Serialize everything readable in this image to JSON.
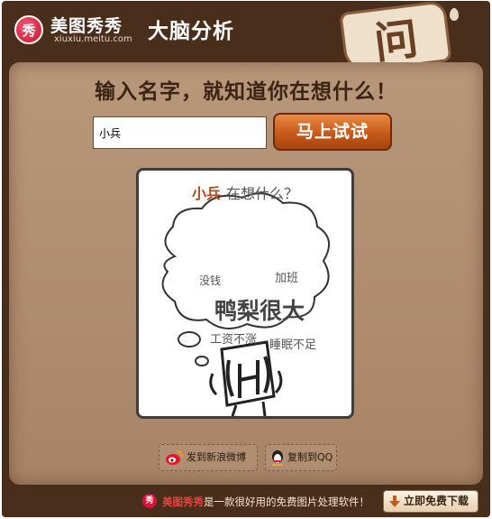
{
  "header": {
    "logo_glyph": "秀",
    "brand_name": "美图秀秀",
    "brand_url": "xiuxiu.meitu.com",
    "title": "大脑分析",
    "banner_glyph": "问"
  },
  "main": {
    "headline": "输入名字，就知道你在想什么！",
    "name_input_value": "小兵",
    "try_button_label": "马上试试"
  },
  "result": {
    "name": "小兵",
    "question": "在想什么？",
    "main_thought": "鸭梨很大",
    "thoughts": [
      "没钱",
      "加班",
      "工资不涨",
      "睡眠不足"
    ]
  },
  "share": {
    "weibo_label": "发到新浪微博",
    "qq_label": "复制到QQ"
  },
  "footer": {
    "brand": "美图秀秀",
    "tagline": "是一款很好用的免费图片处理软件！",
    "download_label": "立即免费下载"
  },
  "colors": {
    "frame": "#4a2e1c",
    "panel": "#b8977a",
    "accent_orange": "#c65a18",
    "name_highlight": "#b2471d",
    "brand_red": "#d4163c"
  },
  "icons": [
    "meitu-logo-icon",
    "question-banner-icon",
    "weibo-icon",
    "qq-penguin-icon",
    "download-arrow-icon"
  ]
}
